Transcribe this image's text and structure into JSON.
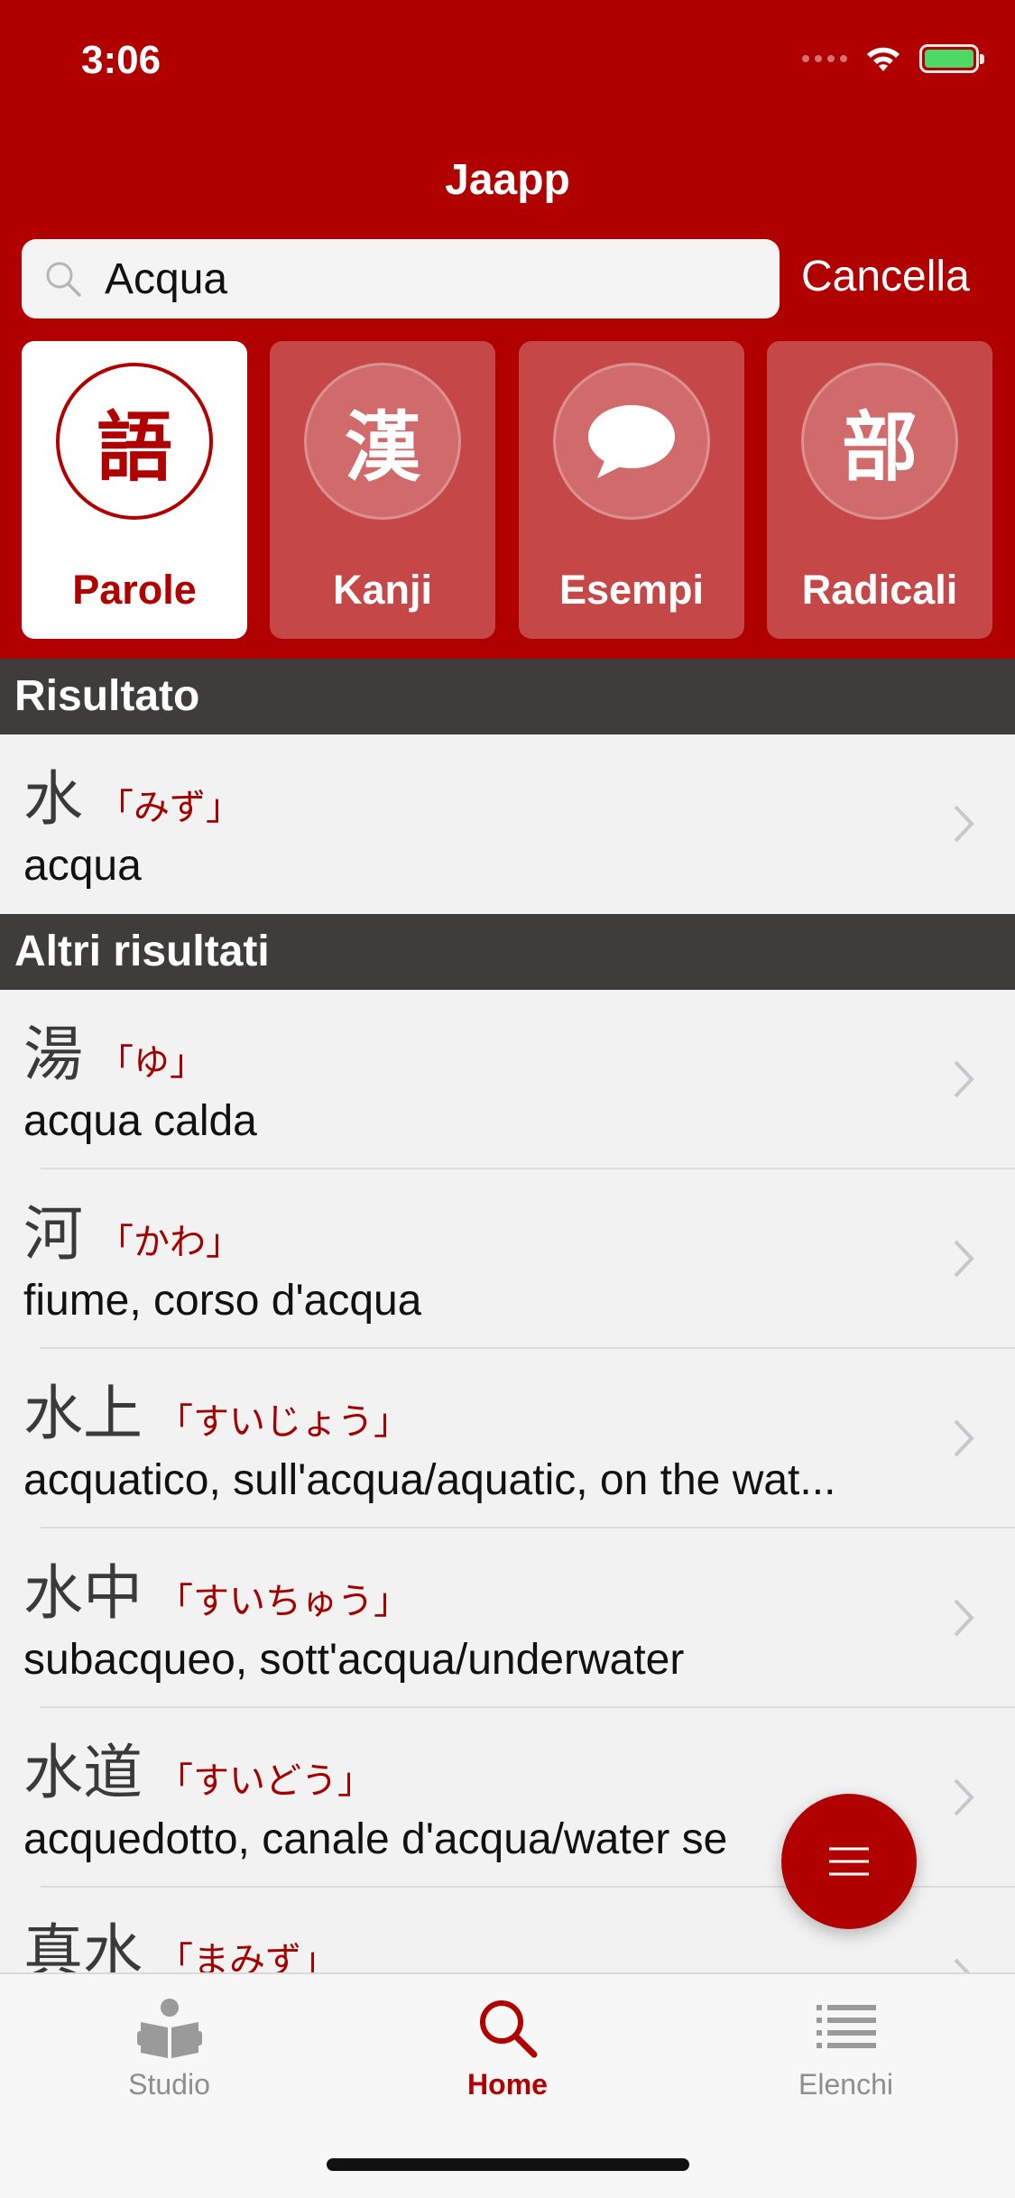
{
  "status_bar": {
    "time": "3:06"
  },
  "app": {
    "title": "Jaapp"
  },
  "search": {
    "value": "Acqua",
    "cancel_label": "Cancella"
  },
  "categories": [
    {
      "glyph": "語",
      "label": "Parole",
      "active": true
    },
    {
      "glyph": "漢",
      "label": "Kanji",
      "active": false
    },
    {
      "glyph": "",
      "icon": "speech-bubble-icon",
      "label": "Esempi",
      "active": false
    },
    {
      "glyph": "部",
      "label": "Radicali",
      "active": false
    }
  ],
  "sections": {
    "result_header": "Risultato",
    "others_header": "Altri risultati"
  },
  "result": [
    {
      "word": "水",
      "reading": "「みず」",
      "meaning": "acqua"
    }
  ],
  "other_results": [
    {
      "word": "湯",
      "reading": "「ゆ」",
      "meaning": "acqua calda"
    },
    {
      "word": "河",
      "reading": "「かわ」",
      "meaning": "fiume, corso d'acqua"
    },
    {
      "word": "水上",
      "reading": "「すいじょう」",
      "meaning": "acquatico, sull'acqua/aquatic, on the wat..."
    },
    {
      "word": "水中",
      "reading": "「すいちゅう」",
      "meaning": "subacqueo, sott'acqua/underwater"
    },
    {
      "word": "水道",
      "reading": "「すいどう」",
      "meaning": "acquedotto, canale d'acqua/water se"
    },
    {
      "word": "真水",
      "reading": "「まみず」",
      "meaning": ""
    }
  ],
  "tabbar": [
    {
      "label": "Studio",
      "icon": "book-reader-icon",
      "active": false
    },
    {
      "label": "Home",
      "icon": "search-icon",
      "active": true
    },
    {
      "label": "Elenchi",
      "icon": "list-icon",
      "active": false
    }
  ],
  "colors": {
    "accent": "#b00000",
    "section_header": "#3f3d3a",
    "background": "#f2f2f2"
  }
}
